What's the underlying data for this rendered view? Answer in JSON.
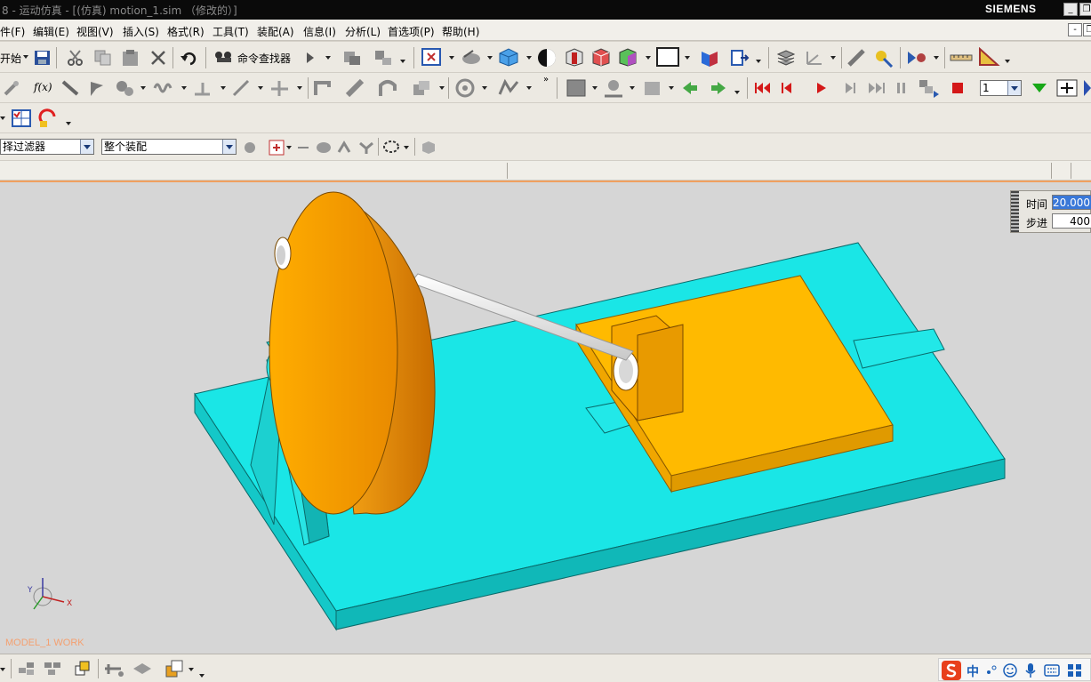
{
  "window": {
    "title": "8 - 运动仿真 - [(仿真) motion_1.sim （修改的）]",
    "brand": "SIEMENS",
    "min_label": "_",
    "restore_label": "❐"
  },
  "menu": {
    "items": [
      "件(F)",
      "编辑(E)",
      "视图(V)",
      "插入(S)",
      "格式(R)",
      "工具(T)",
      "装配(A)",
      "信息(I)",
      "分析(L)",
      "首选项(P)",
      "帮助(H)"
    ],
    "min_label": "-",
    "restore_label": "❐"
  },
  "toolbar": {
    "start_label": "开始",
    "command_finder_label": "命令查找器",
    "frame_value": "1"
  },
  "selection": {
    "filter_value": "择过滤器",
    "scope_value": "整个装配"
  },
  "animation": {
    "time_label": "时间",
    "time_value": "20.000",
    "step_label": "步进",
    "step_value": "400"
  },
  "viewport": {
    "work_label": "MODEL_1 WORK",
    "triad_x": "X",
    "triad_y": "Y"
  },
  "ime": {
    "language": "中"
  },
  "colors": {
    "base_plate": "#19e4e4",
    "wheel": "#f7a800",
    "slider": "#f7b800",
    "rod": "#f4f4f4",
    "viewport_bg": "#d6d6d6",
    "accent": "#f0a060"
  }
}
